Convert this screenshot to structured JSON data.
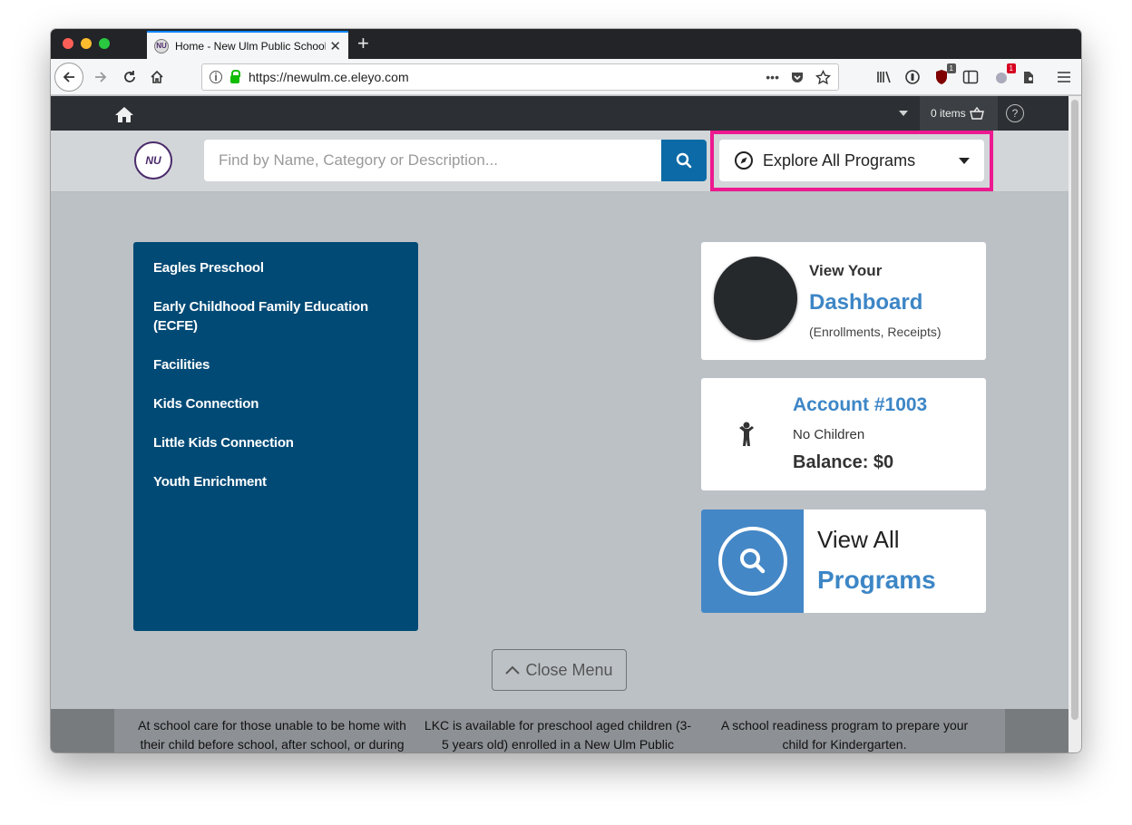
{
  "browser": {
    "tab_title": "Home - New Ulm Public School",
    "favicon_text": "NU",
    "url": "https://newulm.ce.eleyo.com",
    "url_actions": "•••",
    "toolbar_badges": {
      "ublock": "1",
      "extension": "1"
    }
  },
  "topnav": {
    "cart_label": "0 items",
    "help_label": "?"
  },
  "header": {
    "logo_text": "NU",
    "search_placeholder": "Find by Name, Category or Description...",
    "explore_label": "Explore All Programs"
  },
  "menu": {
    "items": [
      {
        "label": "Eagles Preschool"
      },
      {
        "label": "Early Childhood Family Education (ECFE)"
      },
      {
        "label": "Facilities"
      },
      {
        "label": "Kids Connection"
      },
      {
        "label": "Little Kids Connection"
      },
      {
        "label": "Youth Enrichment"
      }
    ]
  },
  "dashboard_card": {
    "line1": "View Your",
    "line2": "Dashboard",
    "line3": "(Enrollments, Receipts)"
  },
  "account_card": {
    "account": "Account #1003",
    "children": "No Children",
    "balance": "Balance: $0"
  },
  "programs_card": {
    "line1": "View All",
    "line2": "Programs"
  },
  "close_menu_label": "Close Menu",
  "footer": {
    "col1": "At school care for those unable to be home with their child before school, after school, or during summer.",
    "col2": "LKC is available for preschool aged children (3-5 years old) enrolled in a New Ulm Public Schools preschool.",
    "col3": "A school readiness program to prepare your child for Kindergarten."
  },
  "colors": {
    "accent": "#0c6aa6",
    "menu_bg": "#004a75",
    "link_blue": "#3d86c6",
    "highlight": "#ec1990"
  }
}
